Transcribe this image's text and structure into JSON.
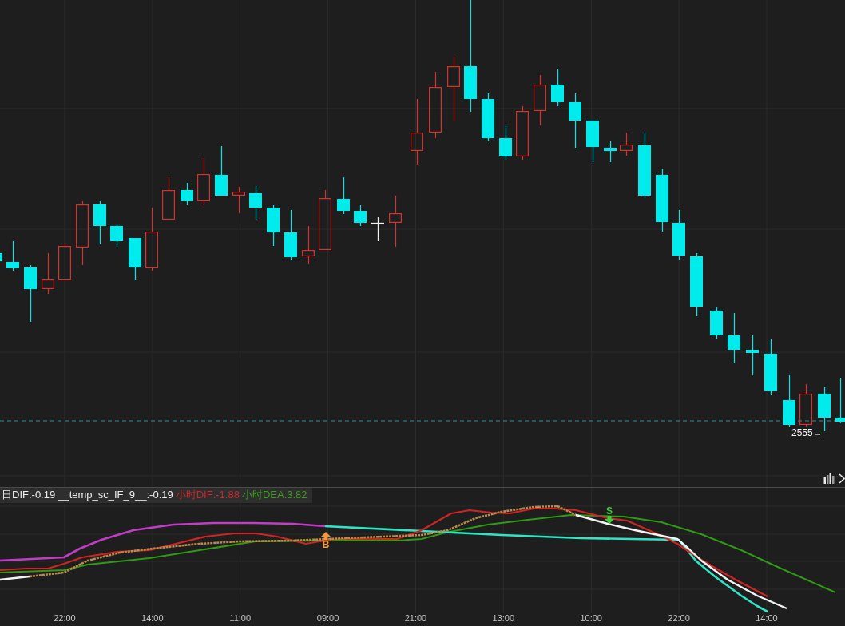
{
  "price_chart": {
    "last_price_label": "2555→"
  },
  "indicator": {
    "legend": [
      {
        "text": "日DIF:-0.19",
        "color": "#ececec"
      },
      {
        "text": "__temp_sc_IF_9__:-0.19",
        "color": "#ececec"
      },
      {
        "text": "小时DIF:-1.88",
        "color": "#c8282a"
      },
      {
        "text": "小时DEA:3.82",
        "color": "#3c9a1e"
      }
    ],
    "signals": [
      {
        "kind": "buy",
        "label": "B"
      },
      {
        "kind": "sell",
        "label": "S"
      }
    ]
  },
  "time_axis": {
    "labels": [
      "22:00",
      "14:00",
      "11:00",
      "09:00",
      "21:00",
      "13:00",
      "10:00",
      "22:00",
      "14:00"
    ]
  }
}
